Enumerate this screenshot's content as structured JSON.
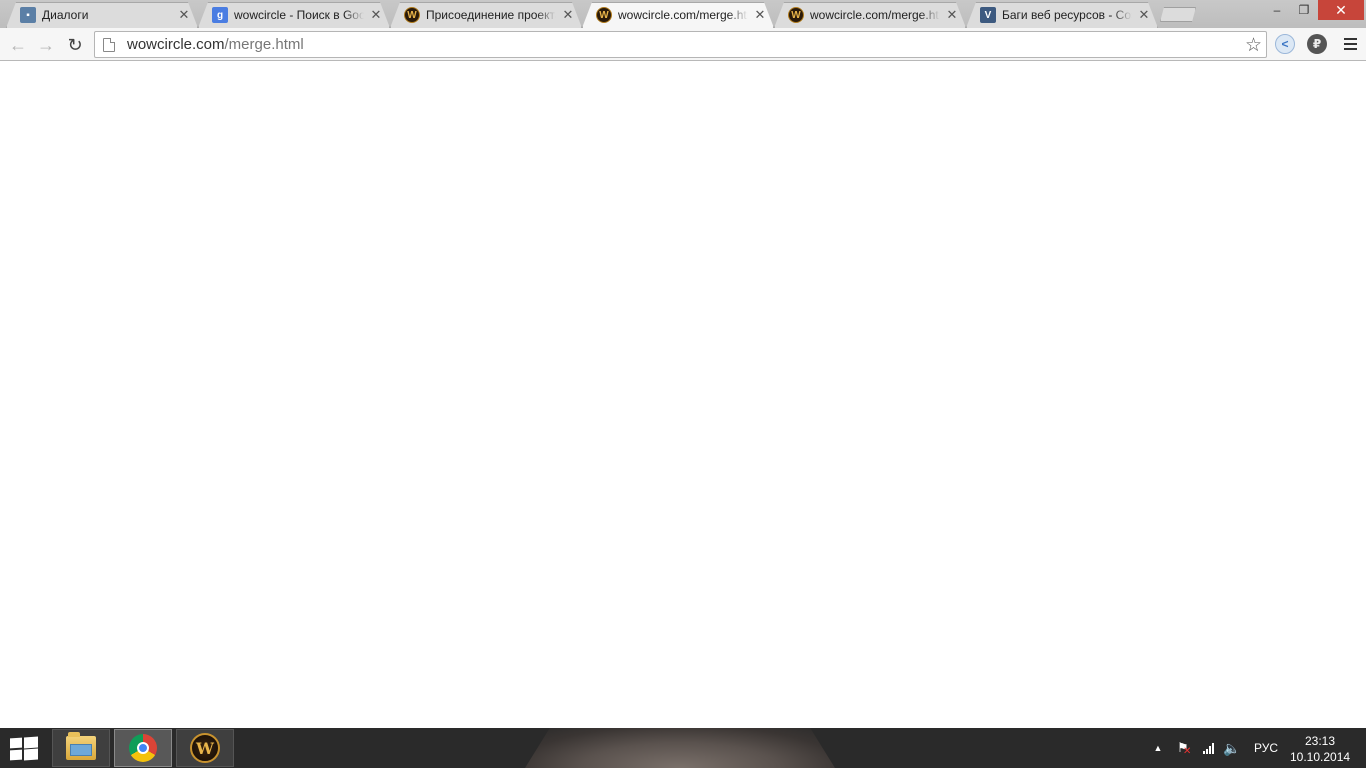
{
  "tabs": [
    {
      "title": "Диалоги",
      "favicon": "vk-dialogs-icon",
      "active": false
    },
    {
      "title": "wowcircle - Поиск в Google",
      "favicon": "google-icon",
      "active": false
    },
    {
      "title": "Присоединение проекта",
      "favicon": "wow-icon",
      "active": false
    },
    {
      "title": "wowcircle.com/merge.html",
      "favicon": "wow-icon",
      "active": true
    },
    {
      "title": "wowcircle.com/merge.html",
      "favicon": "wow-icon",
      "active": false
    },
    {
      "title": "Баги веб ресурсов - Создать",
      "favicon": "bugs-site-icon",
      "active": false
    }
  ],
  "window": {
    "minimize": "–",
    "maximize": "❐",
    "close": "✕"
  },
  "toolbar": {
    "back": "←",
    "forward": "→",
    "reload": "↻",
    "url_host": "wowcircle.com",
    "url_path": "/merge.html",
    "star": "☆",
    "ext_share": "<",
    "ext_rub": "₽"
  },
  "taskbar": {
    "apps": [
      "file-explorer",
      "google-chrome",
      "world-of-warcraft"
    ],
    "language": "РУС",
    "time": "23:13",
    "date": "10.10.2014"
  },
  "colors": {
    "tabstrip": "#c4c4c4",
    "toolbar": "#f6f6f6",
    "taskbar": "#2a2a2a",
    "close_button": "#c7453a"
  }
}
